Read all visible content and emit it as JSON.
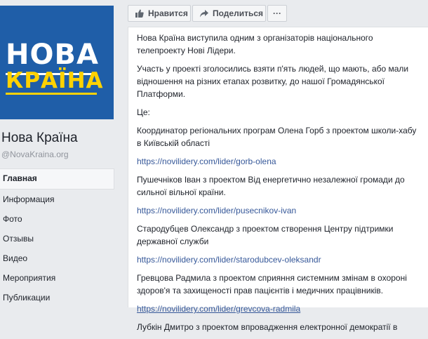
{
  "logo": {
    "line1": "НОВА",
    "line2": "КРАЇНА"
  },
  "page": {
    "name": "Нова Країна",
    "handle": "@NovaKraina.org"
  },
  "sidebar": {
    "items": [
      {
        "label": "Главная"
      },
      {
        "label": "Информация"
      },
      {
        "label": "Фото"
      },
      {
        "label": "Отзывы"
      },
      {
        "label": "Видео"
      },
      {
        "label": "Мероприятия"
      },
      {
        "label": "Публикации"
      }
    ]
  },
  "actions": {
    "like_label": "Нравится",
    "share_label": "Поделиться",
    "more_label": "···"
  },
  "post": {
    "paragraphs": [
      "Нова Країна виступила одним з організаторів національного телепроекту Нові Лідери.",
      "Участь у проекті зголосились взяти п'ять людей, що мають, або мали відношення на різних етапах розвитку, до нашої Громадянської Платформи.",
      "Це:",
      "Координатор регіональних програм Олена Горб з проектом школи-хабу в Київській області",
      "https://novilidery.com/lider/gorb-olena",
      "Пушечніков Іван з проектом Від енергетично незалежної громади до сильної вільної країни.",
      "https://novilidery.com/lider/pusecnikov-ivan",
      "Стародубцев Олександр з проектом створення Центру підтримки державної служби",
      "https://novilidery.com/lider/starodubcev-oleksandr",
      "Гревцова Радмила з проектом сприяння системним змінам в охороні здоров'я та захищеності прав пацієнтів і медичних працівників.",
      "https://novilidery.com/lider/grevcova-radmila",
      "Лубкін Дмитро з проектом впровадження електронної демократії в"
    ]
  }
}
